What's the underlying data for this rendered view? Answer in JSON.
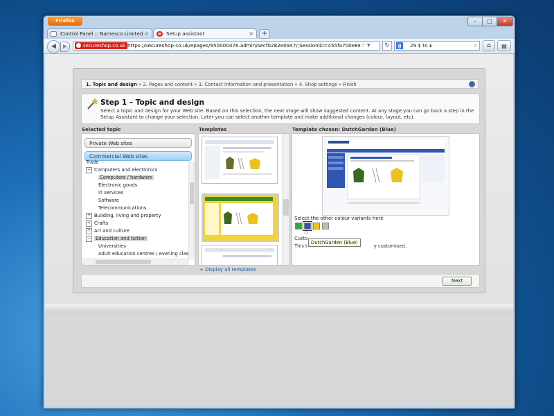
{
  "browser": {
    "menu_button": "Firefox",
    "window_controls": {
      "minimize": "–",
      "maximize": "□",
      "close": "✕"
    },
    "tabs": [
      {
        "label": "Control Panel :: Namesco Limited",
        "close": "×"
      },
      {
        "label": "Setup assistant",
        "close": "×"
      }
    ],
    "new_tab": "+",
    "url": {
      "site_identity": "secureshop.co.uk",
      "value": "https://secureshop.co.uk/epages/950000476.admin/secf0282e0947/;SessionID=455fa700e88863c6d6dc"
    },
    "search": {
      "engine_icon": "g-icon",
      "value": "29 $ to £"
    }
  },
  "assistant": {
    "breadcrumb": {
      "steps": [
        "1. Topic and design",
        "2. Pages and content",
        "3. Contact information and presentation",
        "4. Shop settings",
        "Finish"
      ],
      "separator": "»"
    },
    "step": {
      "title": "Step 1 – Topic and design",
      "description": "Select a topic and design for your Web site. Based on this selection, the next stage will show suggested content. At any stage you can go back a step in the Setup Assistant to change your selection. Later you can select another template and make additional changes (colour, layout, etc)."
    },
    "columns": {
      "topic": "Selected topic",
      "templates": "Templates",
      "chosen": "Template chosen: DutchGarden (Blue)"
    },
    "topic_buttons": {
      "private": "Private Web sites",
      "commercial": "Commercial Web sites"
    },
    "tree": [
      {
        "label": "Trade",
        "toggle": "",
        "indent": 0
      },
      {
        "label": "Computers and electronics",
        "toggle": "−",
        "indent": 0
      },
      {
        "label": "Computers / hardware",
        "toggle": "",
        "indent": 1,
        "selected": true
      },
      {
        "label": "Electronic goods",
        "toggle": "",
        "indent": 1
      },
      {
        "label": "IT services",
        "toggle": "",
        "indent": 1
      },
      {
        "label": "Software",
        "toggle": "",
        "indent": 1
      },
      {
        "label": "Telecommunications",
        "toggle": "",
        "indent": 1
      },
      {
        "label": "Building, living and property",
        "toggle": "+",
        "indent": 0
      },
      {
        "label": "Crafts",
        "toggle": "+",
        "indent": 0
      },
      {
        "label": "Art and culture",
        "toggle": "+",
        "indent": 0
      },
      {
        "label": "Education and tuition",
        "toggle": "−",
        "indent": 0,
        "selected": true
      },
      {
        "label": "Universities",
        "toggle": "",
        "indent": 1
      },
      {
        "label": "Adult education centres / evening classes",
        "toggle": "",
        "indent": 1
      }
    ],
    "chosen": {
      "variants_label": "Select the other colour variants here",
      "swatch_colors": [
        "#3aa33a",
        "#2f55b5",
        "#e8c81a",
        "#bcbcbc"
      ],
      "tooltip": "DutchGarden (Blue)",
      "customise_line1": "Custo",
      "customise_line2": "This t",
      "customise_tail": "y customised."
    },
    "display_all": "+ Display all templates",
    "next_button": "Next"
  }
}
